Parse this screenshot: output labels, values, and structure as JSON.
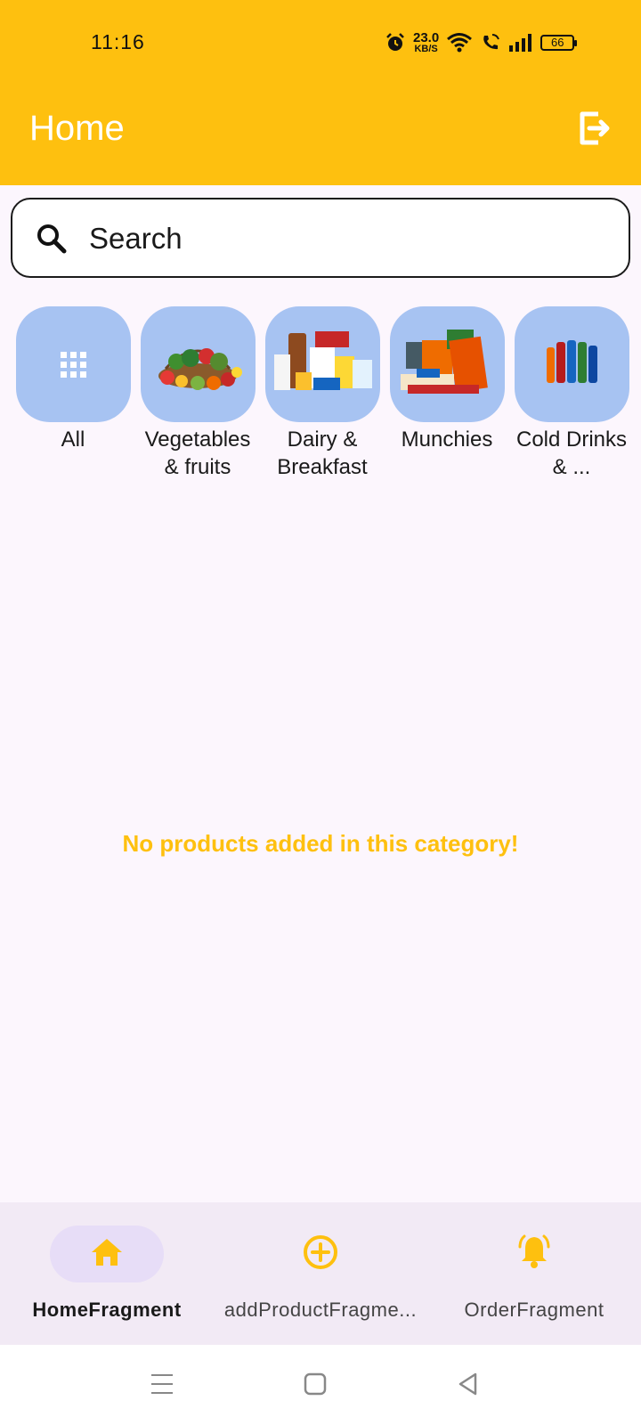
{
  "status_bar": {
    "time": "11:16",
    "net_speed_value": "23.0",
    "net_speed_unit": "KB/S",
    "battery": "66"
  },
  "app_bar": {
    "title": "Home"
  },
  "search": {
    "placeholder": "Search"
  },
  "categories": [
    {
      "label": "All",
      "icon": "grid-icon"
    },
    {
      "label": "Vegetables & fruits",
      "icon": "vegetables-image"
    },
    {
      "label": "Dairy & Breakfast",
      "icon": "dairy-image"
    },
    {
      "label": "Munchies",
      "icon": "munchies-image"
    },
    {
      "label": "Cold Drinks & ...",
      "icon": "cold-drinks-image"
    }
  ],
  "empty_message": "No products added in this category!",
  "bottom_nav": [
    {
      "label": "HomeFragment",
      "icon": "home-icon",
      "active": true
    },
    {
      "label": "addProductFragme...",
      "icon": "add-circle-icon",
      "active": false
    },
    {
      "label": "OrderFragment",
      "icon": "bell-icon",
      "active": false
    }
  ],
  "colors": {
    "accent": "#fec00f",
    "tile": "#a7c3f2",
    "background": "#fcf6fd",
    "nav_bg": "#f2eaf5",
    "nav_active": "#e7ddf7"
  }
}
